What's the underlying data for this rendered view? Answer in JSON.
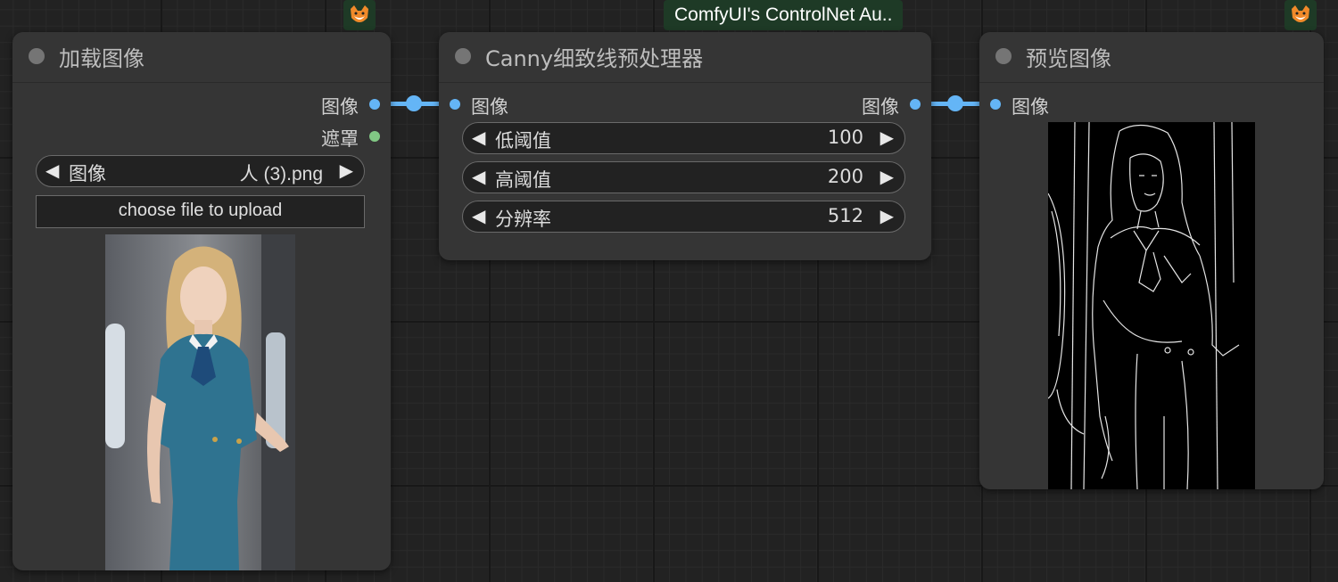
{
  "colors": {
    "canvas_bg": "#222222",
    "node_bg": "#353535",
    "image_socket": "#64b5f6",
    "mask_socket": "#81c784",
    "badge_bg": "#1e3a26"
  },
  "badges": {
    "controlnet_aux": "ComfyUI's ControlNet Au..",
    "fox_icon": "fox-icon"
  },
  "load_image_node": {
    "title": "加载图像",
    "outputs": [
      "图像",
      "遮罩"
    ],
    "image_widget": {
      "label": "图像",
      "value": "人 (3).png"
    },
    "upload_button": "choose file to upload",
    "preview_image": "photo-preview"
  },
  "canny_node": {
    "title": "Canny细致线预处理器",
    "input": "图像",
    "output": "图像",
    "widgets": [
      {
        "label": "低阈值",
        "value": "100"
      },
      {
        "label": "高阈值",
        "value": "200"
      },
      {
        "label": "分辨率",
        "value": "512"
      }
    ]
  },
  "preview_node": {
    "title": "预览图像",
    "input": "图像",
    "preview_image": "edge-preview"
  }
}
